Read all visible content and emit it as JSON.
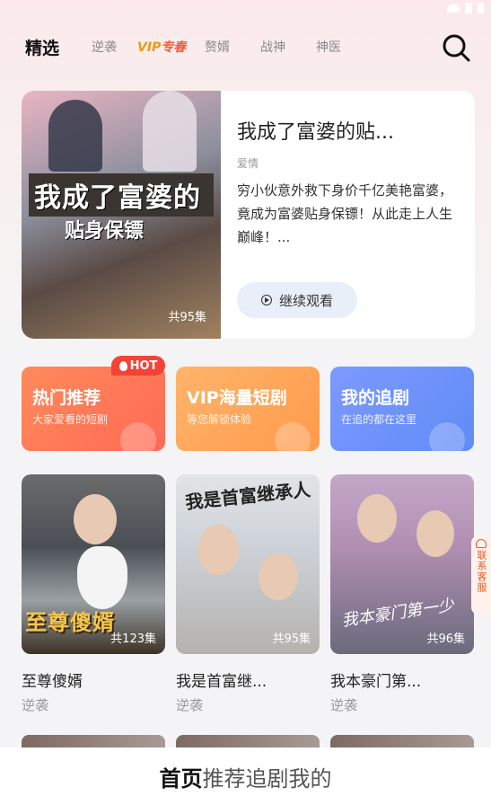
{
  "nav": {
    "tabs": [
      "精选",
      "逆袭",
      "赘婿",
      "战神",
      "神医"
    ],
    "vip_tab": {
      "v": "VIP",
      "z": "专春"
    }
  },
  "featured": {
    "title": "我成了富婆的贴...",
    "genre": "爱情",
    "description": "穷小伙意外救下身价千亿美艳富婆，竟成为富婆贴身保镖！从此走上人生巅峰！...",
    "poster_text_line1": "我成了富婆的",
    "poster_text_line2": "贴身保镖",
    "episodes": "共95集",
    "continue_label": "继续观看"
  },
  "categories": [
    {
      "title": "热门推荐",
      "subtitle": "大家爱看的短剧",
      "color": "#ff7a58"
    },
    {
      "title": "VIP海量短剧",
      "subtitle": "等您解锁体验",
      "color": "#ffa85a"
    },
    {
      "title": "我的追剧",
      "subtitle": "在追的都在这里",
      "color": "#6d92fa"
    }
  ],
  "hot_badge": "HOT",
  "dramas": [
    {
      "name": "至尊傻婿",
      "genre": "逆袭",
      "episodes": "共123集",
      "poster_text": "至尊傻婿"
    },
    {
      "name": "我是首富继...",
      "genre": "逆袭",
      "episodes": "共95集",
      "poster_text": "我是首富继承人"
    },
    {
      "name": "我本豪门第...",
      "genre": "逆袭",
      "episodes": "共96集",
      "poster_text": "我本豪门第一少"
    }
  ],
  "contact_label": "联系客服",
  "bottom_nav": [
    "首页",
    "推荐",
    "追剧",
    "我的"
  ],
  "colors": {
    "accent_red": "#f44336",
    "vip_gold": "#e89a1c"
  }
}
